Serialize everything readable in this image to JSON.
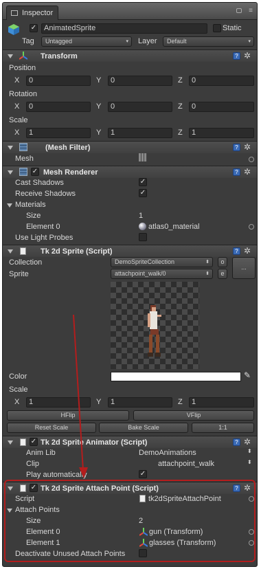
{
  "window": {
    "tab": "Inspector",
    "tab_icon": "inspector-icon",
    "menu_icon": "menu-icon",
    "lock_icon": "lock-icon"
  },
  "object": {
    "name": "AnimatedSprite",
    "static_label": "Static",
    "tag_label": "Tag",
    "tag_value": "Untagged",
    "layer_label": "Layer",
    "layer_value": "Default",
    "active": true,
    "static": false
  },
  "transform": {
    "title": "Transform",
    "position_label": "Position",
    "rotation_label": "Rotation",
    "scale_label": "Scale",
    "x": "X",
    "y": "Y",
    "z": "Z",
    "position": [
      "0",
      "0",
      "0"
    ],
    "rotation": [
      "0",
      "0",
      "0"
    ],
    "scale": [
      "1",
      "1",
      "1"
    ]
  },
  "mesh_filter": {
    "title": "(Mesh Filter)",
    "mesh_label": "Mesh"
  },
  "mesh_renderer": {
    "title": "Mesh Renderer",
    "cast_shadows": "Cast Shadows",
    "receive_shadows": "Receive Shadows",
    "materials": "Materials",
    "size_label": "Size",
    "size_value": "1",
    "element0_label": "Element 0",
    "element0_value": "atlas0_material",
    "light_probes": "Use Light Probes"
  },
  "sprite": {
    "title": "Tk 2d Sprite (Script)",
    "collection_label": "Collection",
    "collection_value": "DemoSpriteCollection",
    "sprite_label": "Sprite",
    "sprite_value": "attachpoint_walk/0",
    "o_btn": "o",
    "e_btn": "e",
    "more_btn": "...",
    "color_label": "Color",
    "scale_label": "Scale",
    "scale": [
      "1",
      "1",
      "1"
    ],
    "hflip": "HFlip",
    "vflip": "VFlip",
    "reset_scale": "Reset Scale",
    "bake_scale": "Bake Scale",
    "one_to_one": "1:1"
  },
  "animator": {
    "title": "Tk 2d Sprite Animator (Script)",
    "anim_lib_label": "Anim Lib",
    "anim_lib_value": "DemoAnimations",
    "clip_label": "Clip",
    "clip_value": "attachpoint_walk",
    "play_label": "Play automatically"
  },
  "attach": {
    "title": "Tk 2d Sprite Attach Point (Script)",
    "script_label": "Script",
    "script_value": "tk2dSpriteAttachPoint",
    "attach_points_label": "Attach Points",
    "size_label": "Size",
    "size_value": "2",
    "element0_label": "Element 0",
    "element0_value": "gun (Transform)",
    "element1_label": "Element 1",
    "element1_value": "glasses (Transform)",
    "deactivate_label": "Deactivate Unused Attach Points"
  },
  "colors": {
    "highlight": "#b31d1d",
    "help": "#3a6ab5"
  }
}
